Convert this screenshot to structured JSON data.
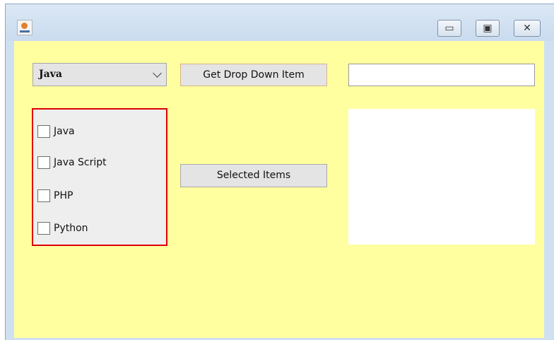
{
  "window": {
    "controls": [
      "minimize-icon",
      "maximize-icon",
      "close-icon"
    ]
  },
  "combo": {
    "selected": "Java"
  },
  "buttons": {
    "get_dropdown": "Get Drop Down Item",
    "selected_items": "Selected Items"
  },
  "textfield": {
    "value": ""
  },
  "checkboxes": [
    {
      "label": "Java",
      "checked": false
    },
    {
      "label": "Java Script",
      "checked": false
    },
    {
      "label": "PHP",
      "checked": false
    },
    {
      "label": "Python",
      "checked": false
    }
  ],
  "colors": {
    "content_bg": "#ffffa0",
    "panel_border": "#e00000"
  }
}
